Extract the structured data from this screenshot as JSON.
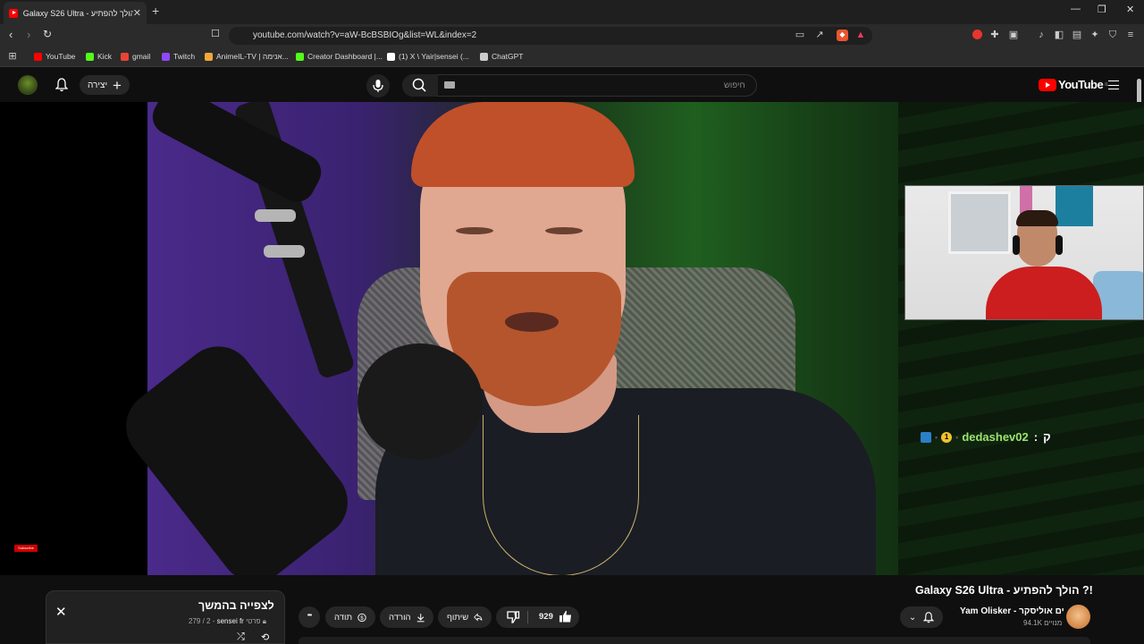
{
  "browser": {
    "tab_title": "Galaxy S26 Ultra - הולך להפתיע",
    "tab_close": "✕",
    "new_tab": "+",
    "url": "youtube.com/watch?v=aW-BcBSBIOg&list=WL&index=2",
    "window_controls": {
      "minimize": "—",
      "restore": "❐",
      "close": "✕"
    },
    "bookmarks": [
      {
        "label": "YouTube",
        "color": "#ff0000"
      },
      {
        "label": "Kick",
        "color": "#53fc18"
      },
      {
        "label": "gmail",
        "color": "#ea4335"
      },
      {
        "label": "Twitch",
        "color": "#9146ff"
      },
      {
        "label": "AnimeIL-TV | אנימה...",
        "color": "#f4a63a"
      },
      {
        "label": "Creator Dashboard |...",
        "color": "#53fc18"
      },
      {
        "label": "(1) X \\ Yair|sensei (...",
        "color": "#ffffff"
      },
      {
        "label": "ChatGPT",
        "color": "#cccccc"
      }
    ]
  },
  "youtube_header": {
    "create_label": "יצירה",
    "search_placeholder": "חיפוש",
    "logo_text": "YouTube",
    "logo_country": "IL"
  },
  "video": {
    "chat_line": {
      "username": "dedashev02",
      "separator": ":",
      "message": "ק",
      "badge_count": "1"
    },
    "subscribe_badge": "Subscribe"
  },
  "below_video": {
    "title": "Galaxy S26 Ultra - הולך להפתיע ?!",
    "channel_name": "Yam Olisker - ים אוליסקר",
    "subscribers": "94.1K מנויים",
    "like_count": "929",
    "share_label": "שיתוף",
    "download_label": "הורדה",
    "thanks_label": "תודה",
    "more_label": "•••"
  },
  "watch_later_panel": {
    "title": "לצפייה בהמשך",
    "owner": "sensei fr",
    "privacy": "פרטי",
    "position": "279 / 2",
    "close": "✕"
  },
  "colors": {
    "youtube_red": "#ff0000",
    "chat_username": "#9de26e",
    "pill_bg": "#272727"
  }
}
